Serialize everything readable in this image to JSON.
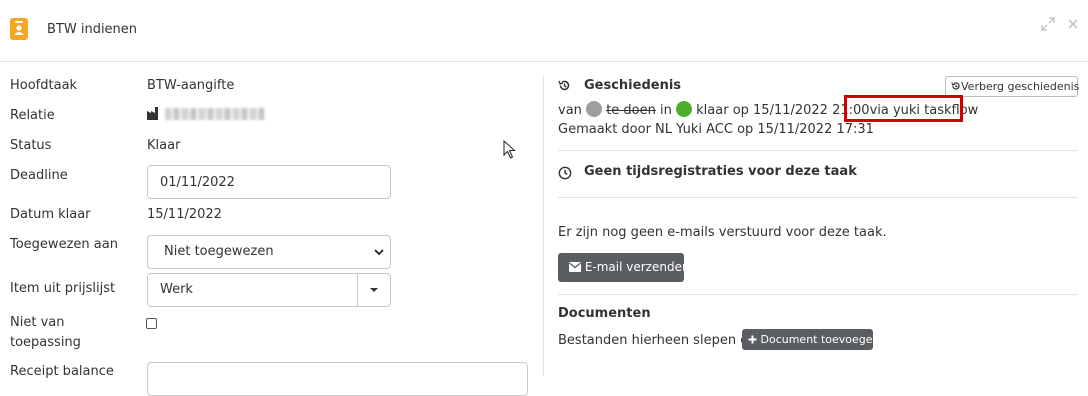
{
  "header": {
    "title": "BTW indienen"
  },
  "form": {
    "hoofdtaak": {
      "label": "Hoofdtaak",
      "value": "BTW-aangifte"
    },
    "relatie": {
      "label": "Relatie",
      "value": ""
    },
    "status": {
      "label": "Status",
      "value": "Klaar"
    },
    "deadline": {
      "label": "Deadline",
      "value": "01/11/2022"
    },
    "datum_klaar": {
      "label": "Datum klaar",
      "value": "15/11/2022"
    },
    "toegewezen": {
      "label": "Toegewezen aan",
      "selected": "Niet toegewezen"
    },
    "prijslijst": {
      "label": "Item uit prijslijst",
      "value": "Werk"
    },
    "niet_van_toepassing": {
      "label_line1": "Niet van",
      "label_line2": "toepassing",
      "checked": false
    },
    "receipt_balance": {
      "label": "Receipt balance",
      "value": ""
    }
  },
  "history": {
    "title": "Geschiedenis",
    "hide_button": "Verberg geschiedenis",
    "line1": {
      "van": "van",
      "from_status": "te doen",
      "in": "in",
      "to_status": "klaar op 15/11/2022 21:00",
      "via": "via yuki taskflow"
    },
    "line2": "Gemaakt door NL Yuki ACC op 15/11/2022 17:31"
  },
  "time": {
    "title": "Geen tijdsregistraties voor deze taak"
  },
  "emails": {
    "text": "Er zijn nog geen e-mails verstuurd voor deze taak.",
    "button": "E-mail verzenden"
  },
  "documents": {
    "title": "Documenten",
    "drop_text": "Bestanden hierheen slepen of",
    "add_button": "Document toevoegen"
  },
  "colors": {
    "accent_orange": "#f5a623",
    "status_todo": "#9e9e9e",
    "status_done": "#4caf29",
    "highlight": "#d10000",
    "button_dark": "#5a5e63"
  }
}
